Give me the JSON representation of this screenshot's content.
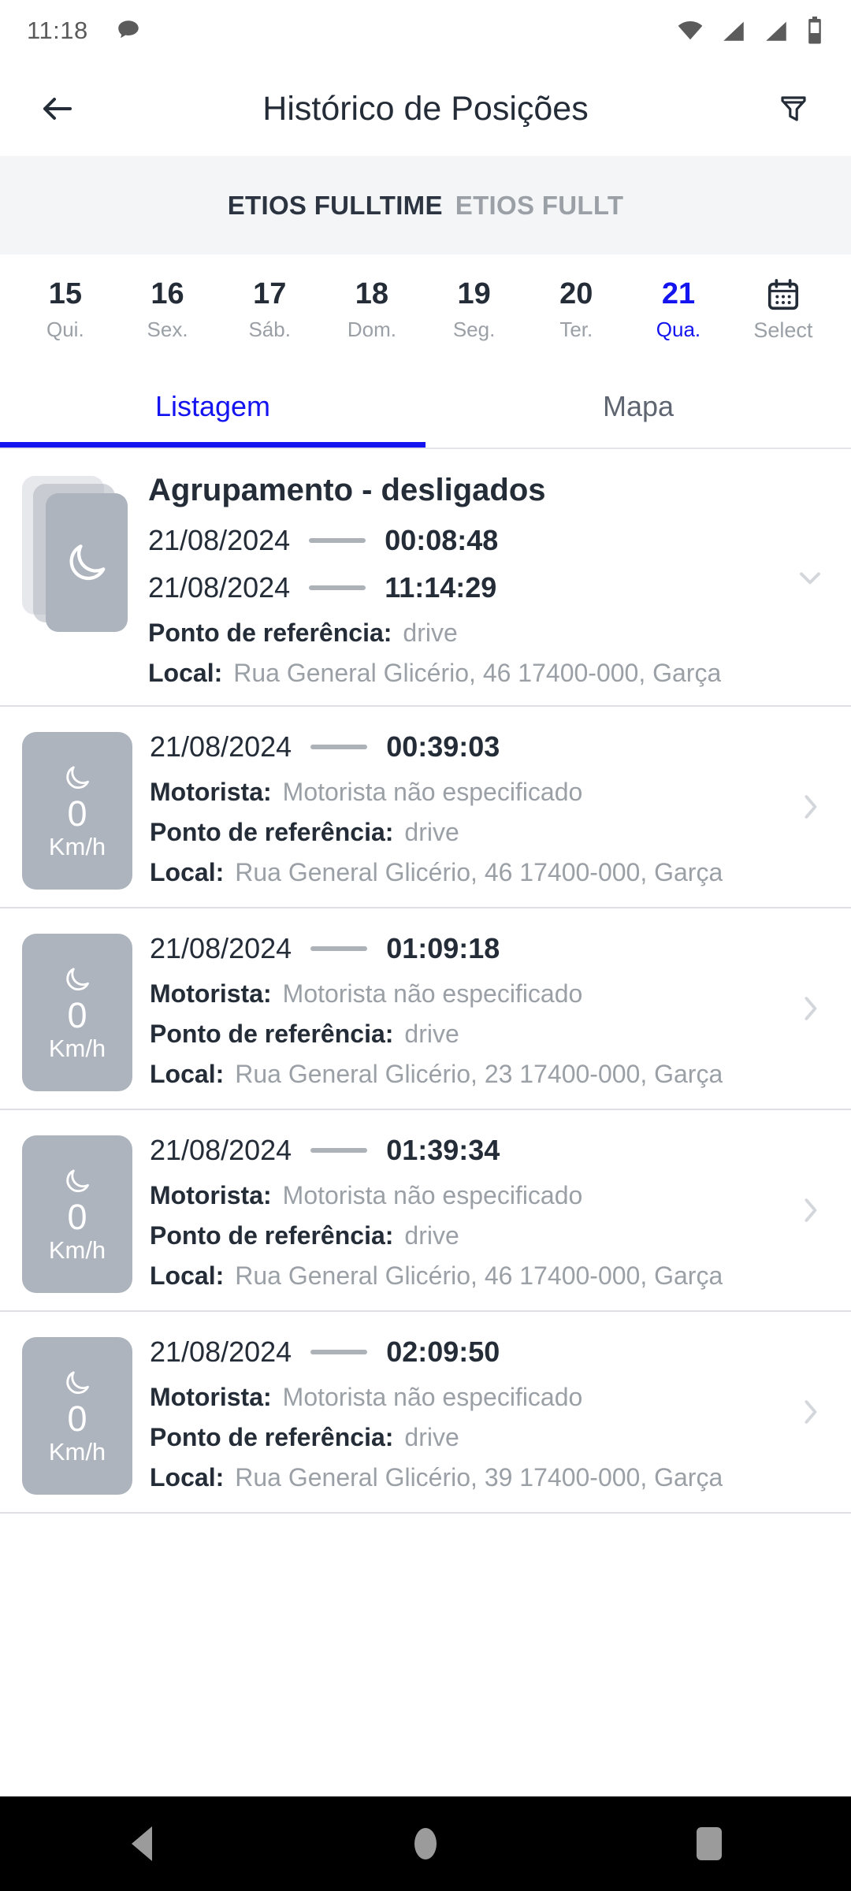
{
  "statusbar": {
    "time": "11:18",
    "icons": [
      "chat-bubble-icon",
      "wifi-icon",
      "signal-icon",
      "signal-icon",
      "battery-icon"
    ]
  },
  "appbar": {
    "back_icon": "arrow-left-icon",
    "title": "Histórico de Posições",
    "filter_icon": "funnel-filter-icon"
  },
  "vehicle": {
    "primary": "ETIOS FULLTIME",
    "secondary": "ETIOS FULLT"
  },
  "daystrip": {
    "days": [
      {
        "num": "15",
        "label": "Qui.",
        "selected": false
      },
      {
        "num": "16",
        "label": "Sex.",
        "selected": false
      },
      {
        "num": "17",
        "label": "Sáb.",
        "selected": false
      },
      {
        "num": "18",
        "label": "Dom.",
        "selected": false
      },
      {
        "num": "19",
        "label": "Seg.",
        "selected": false
      },
      {
        "num": "20",
        "label": "Ter.",
        "selected": false
      },
      {
        "num": "21",
        "label": "Qua.",
        "selected": true
      }
    ],
    "select_label": "Select",
    "select_icon": "calendar-icon"
  },
  "tabs": {
    "items": [
      {
        "label": "Listagem",
        "active": true
      },
      {
        "label": "Mapa",
        "active": false
      }
    ]
  },
  "labels": {
    "motorista": "Motorista:",
    "ponto": "Ponto de referência:",
    "local": "Local:"
  },
  "list": {
    "items": [
      {
        "kind": "group",
        "icon": "moon-stack-icon",
        "title": "Agrupamento - desligados",
        "start_date": "21/08/2024",
        "start_time": "00:08:48",
        "end_date": "21/08/2024",
        "end_time": "11:14:29",
        "ponto": "drive",
        "local": "Rua General Glicério, 46 17400-000, Garça",
        "chevron": "chevron-down-icon"
      },
      {
        "kind": "position",
        "icon": "moon-icon",
        "speed": "0",
        "speed_unit": "Km/h",
        "date": "21/08/2024",
        "time": "00:39:03",
        "motorista": "Motorista não especificado",
        "ponto": "drive",
        "local": "Rua General Glicério, 46 17400-000, Garça",
        "chevron": "chevron-right-icon"
      },
      {
        "kind": "position",
        "icon": "moon-icon",
        "speed": "0",
        "speed_unit": "Km/h",
        "date": "21/08/2024",
        "time": "01:09:18",
        "motorista": "Motorista não especificado",
        "ponto": "drive",
        "local": "Rua General Glicério, 23 17400-000, Garça",
        "chevron": "chevron-right-icon"
      },
      {
        "kind": "position",
        "icon": "moon-icon",
        "speed": "0",
        "speed_unit": "Km/h",
        "date": "21/08/2024",
        "time": "01:39:34",
        "motorista": "Motorista não especificado",
        "ponto": "drive",
        "local": "Rua General Glicério, 46 17400-000, Garça",
        "chevron": "chevron-right-icon"
      },
      {
        "kind": "position",
        "icon": "moon-icon",
        "speed": "0",
        "speed_unit": "Km/h",
        "date": "21/08/2024",
        "time": "02:09:50",
        "motorista": "Motorista não especificado",
        "ponto": "drive",
        "local": "Rua General Glicério, 39 17400-000, Garça",
        "chevron": "chevron-right-icon"
      }
    ]
  },
  "navbar": {
    "back_icon": "nav-back-triangle-icon",
    "home_icon": "nav-home-circle-icon",
    "recents_icon": "nav-recents-square-icon"
  },
  "colors": {
    "accent": "#1414f0",
    "text_dark": "#242c38",
    "text_muted": "#9aa0a6",
    "badge_gray": "#aeb4bd",
    "vehicle_bar_bg": "#f4f5f7"
  }
}
